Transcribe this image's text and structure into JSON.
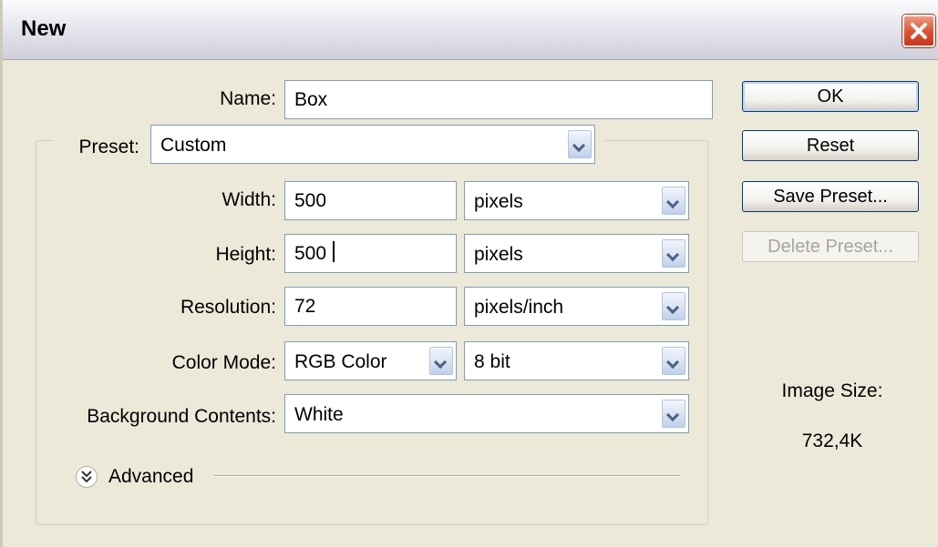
{
  "window": {
    "title": "New"
  },
  "form": {
    "name": {
      "label": "Name:",
      "value": "Box"
    },
    "preset": {
      "label": "Preset:",
      "value": "Custom"
    },
    "width": {
      "label": "Width:",
      "value": "500",
      "unit": "pixels"
    },
    "height": {
      "label": "Height:",
      "value": "500",
      "unit": "pixels"
    },
    "resolution": {
      "label": "Resolution:",
      "value": "72",
      "unit": "pixels/inch"
    },
    "color_mode": {
      "label": "Color Mode:",
      "value": "RGB Color",
      "depth": "8 bit"
    },
    "background": {
      "label": "Background Contents:",
      "value": "White"
    },
    "advanced": {
      "label": "Advanced"
    }
  },
  "buttons": {
    "ok": "OK",
    "reset": "Reset",
    "save_preset": "Save Preset...",
    "delete_preset": "Delete Preset..."
  },
  "image_size": {
    "label": "Image Size:",
    "value": "732,4K"
  },
  "icons": {
    "close": "close-icon",
    "dropdown": "chevron-down-icon",
    "advanced": "double-chevron-down-icon"
  },
  "colors": {
    "close_button": "#dd4f2d",
    "field_border": "#7f9db9",
    "dialog_bg": "#ece9d8"
  }
}
